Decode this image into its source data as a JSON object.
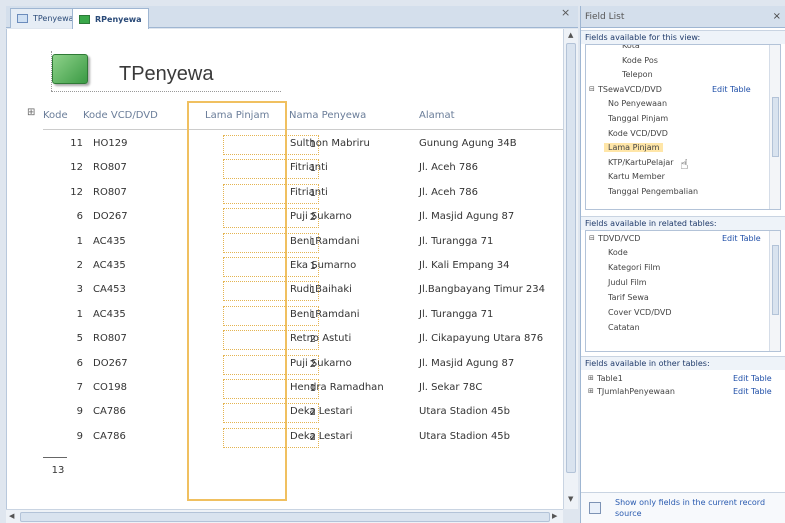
{
  "tabs": [
    {
      "label": "TPenyewa",
      "active": false
    },
    {
      "label": "RPenyewa",
      "active": true
    }
  ],
  "report": {
    "title": "TPenyewa",
    "headers": [
      "Kode",
      "Kode VCD/DVD",
      "Lama Pinjam",
      "Nama Penyewa",
      "Alamat"
    ],
    "rows": [
      {
        "kode": "11",
        "vcd": "HO129",
        "pinjam": "1",
        "nama": "Sulthon Mabriru",
        "alamat": "Gunung Agung 34B"
      },
      {
        "kode": "12",
        "vcd": "RO807",
        "pinjam": "1",
        "nama": "Fitrianti",
        "alamat": "Jl. Aceh 786"
      },
      {
        "kode": "12",
        "vcd": "RO807",
        "pinjam": "1",
        "nama": "Fitrianti",
        "alamat": "Jl. Aceh 786"
      },
      {
        "kode": "6",
        "vcd": "DO267",
        "pinjam": "2",
        "nama": "Puji Sukarno",
        "alamat": "Jl. Masjid Agung 87"
      },
      {
        "kode": "1",
        "vcd": "AC435",
        "pinjam": "1",
        "nama": "Beni Ramdani",
        "alamat": "Jl. Turangga 71"
      },
      {
        "kode": "2",
        "vcd": "AC435",
        "pinjam": "1",
        "nama": "Eka Sumarno",
        "alamat": "Jl. Kali Empang 34"
      },
      {
        "kode": "3",
        "vcd": "CA453",
        "pinjam": "1",
        "nama": "Rudi Baihaki",
        "alamat": "Jl.Bangbayang Timur 234"
      },
      {
        "kode": "1",
        "vcd": "AC435",
        "pinjam": "1",
        "nama": "Beni Ramdani",
        "alamat": "Jl. Turangga 71"
      },
      {
        "kode": "5",
        "vcd": "RO807",
        "pinjam": "2",
        "nama": "Retno Astuti",
        "alamat": "Jl. Cikapayung Utara 876"
      },
      {
        "kode": "6",
        "vcd": "DO267",
        "pinjam": "2",
        "nama": "Puji Sukarno",
        "alamat": "Jl. Masjid Agung 87"
      },
      {
        "kode": "7",
        "vcd": "CO198",
        "pinjam": "1",
        "nama": "Hendra Ramadhan",
        "alamat": "Jl. Sekar 78C"
      },
      {
        "kode": "9",
        "vcd": "CA786",
        "pinjam": "2",
        "nama": "Deka Lestari",
        "alamat": "Utara Stadion 45b"
      },
      {
        "kode": "9",
        "vcd": "CA786",
        "pinjam": "2",
        "nama": "Deka Lestari",
        "alamat": "Utara Stadion 45b"
      }
    ],
    "total": "13"
  },
  "field_list": {
    "title": "Field List",
    "current_section": "Fields available for this view:",
    "current_items": [
      {
        "label": "Kota",
        "type": "field"
      },
      {
        "label": "Kode Pos",
        "type": "field"
      },
      {
        "label": "Telepon",
        "type": "field"
      },
      {
        "label": "TSewaVCD/DVD",
        "type": "table",
        "edit": "Edit Table"
      },
      {
        "label": "No Penyewaan",
        "type": "field"
      },
      {
        "label": "Tanggal Pinjam",
        "type": "field"
      },
      {
        "label": "Kode VCD/DVD",
        "type": "field"
      },
      {
        "label": "Lama Pinjam",
        "type": "field",
        "selected": true
      },
      {
        "label": "KTP/KartuPelajar",
        "type": "field"
      },
      {
        "label": "Kartu Member",
        "type": "field"
      },
      {
        "label": "Tanggal Pengembalian",
        "type": "field"
      }
    ],
    "related_section": "Fields available in related tables:",
    "related_table": {
      "label": "TDVD/VCD",
      "edit": "Edit Table"
    },
    "related_items": [
      "Kode",
      "Kategori Film",
      "Judul Film",
      "Tarif Sewa",
      "Cover VCD/DVD",
      "Catatan"
    ],
    "other_section": "Fields available in other tables:",
    "other_items": [
      {
        "label": "Table1",
        "edit": "Edit Table"
      },
      {
        "label": "TJumlahPenyewaan",
        "edit": "Edit Table"
      }
    ],
    "footer_link": "Show only fields in the current record source"
  },
  "colors": {
    "selection": "#f0c060",
    "selected_field": "#ffe6a8",
    "link": "#1f4fa8"
  }
}
